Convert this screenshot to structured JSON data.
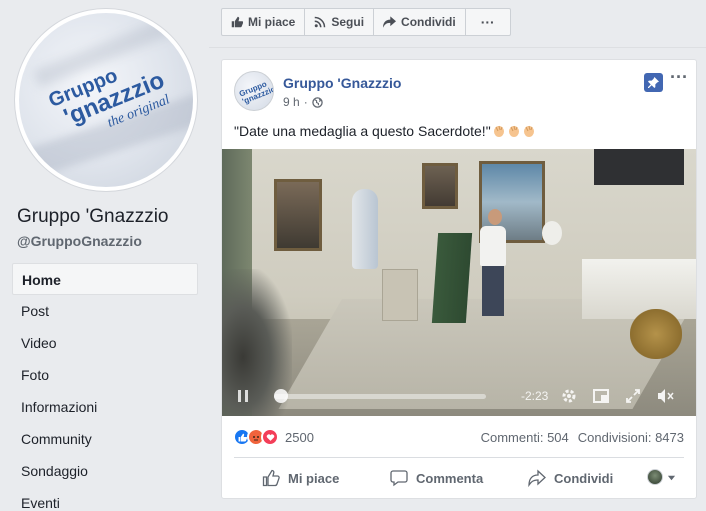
{
  "page": {
    "name": "Gruppo 'Gnazzzio",
    "handle": "@GruppoGnazzzio",
    "logo_line1": "Gruppo",
    "logo_line2": "'gnazzzio",
    "logo_line3": "the original"
  },
  "sidebar": {
    "items": [
      {
        "label": "Home",
        "active": true
      },
      {
        "label": "Post"
      },
      {
        "label": "Video"
      },
      {
        "label": "Foto"
      },
      {
        "label": "Informazioni"
      },
      {
        "label": "Community"
      },
      {
        "label": "Sondaggio"
      },
      {
        "label": "Eventi"
      }
    ]
  },
  "actionbar": {
    "like": "Mi piace",
    "follow": "Segui",
    "share": "Condividi",
    "more": "···"
  },
  "post": {
    "author": "Gruppo 'Gnazzzio",
    "time": "9 h",
    "text": "\"Date una medaglia a questo Sacerdote!\"",
    "emoji_icons": [
      "clapping-hands-icon",
      "clapping-hands-icon",
      "clapping-hands-icon"
    ],
    "video": {
      "remaining_time": "-2:23",
      "progress": 0.0
    },
    "reactions_count": "2500",
    "reaction_icons": [
      "like-icon",
      "angry-icon",
      "love-icon"
    ],
    "comments": "Commenti: 504",
    "shares": "Condivisioni: 8473",
    "actions": {
      "like": "Mi piace",
      "comment": "Commenta",
      "share": "Condividi"
    }
  },
  "colors": {
    "brand_blue": "#4267b2",
    "link_blue": "#365899",
    "page_bg": "#e9ebee"
  }
}
